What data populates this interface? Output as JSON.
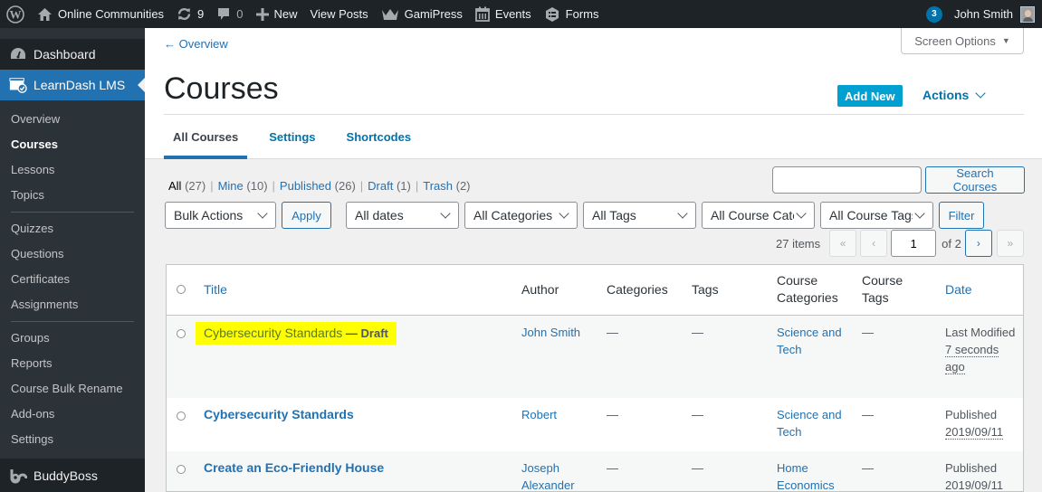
{
  "adminbar": {
    "site_name": "Online Communities",
    "updates_count": "9",
    "comments_count": "0",
    "new_label": "New",
    "view_posts_label": "View Posts",
    "gamipress_label": "GamiPress",
    "events_label": "Events",
    "forms_label": "Forms",
    "notifications_count": "3",
    "user_name": "John Smith"
  },
  "sidebar": {
    "dashboard_label": "Dashboard",
    "learndash_label": "LearnDash LMS",
    "items": [
      {
        "label": "Overview"
      },
      {
        "label": "Courses",
        "active": true
      },
      {
        "label": "Lessons"
      },
      {
        "label": "Topics"
      },
      {
        "label": "Quizzes"
      },
      {
        "label": "Questions"
      },
      {
        "label": "Certificates"
      },
      {
        "label": "Assignments"
      },
      {
        "label": "Groups"
      },
      {
        "label": "Reports"
      },
      {
        "label": "Course Bulk Rename"
      },
      {
        "label": "Add-ons"
      },
      {
        "label": "Settings"
      }
    ],
    "buddyboss_label": "BuddyBoss"
  },
  "header": {
    "back_link": "← Overview",
    "screen_options": "Screen Options",
    "title": "Courses",
    "add_new": "Add New",
    "actions": "Actions",
    "tabs": [
      {
        "label": "All Courses",
        "active": true
      },
      {
        "label": "Settings"
      },
      {
        "label": "Shortcodes"
      }
    ]
  },
  "views": {
    "all": "All",
    "all_count": "(27)",
    "mine": "Mine",
    "mine_count": "(10)",
    "published": "Published",
    "published_count": "(26)",
    "draft": "Draft",
    "draft_count": "(1)",
    "trash": "Trash",
    "trash_count": "(2)"
  },
  "search": {
    "value": "",
    "button": "Search Courses"
  },
  "filters": {
    "bulk_actions": "Bulk Actions",
    "apply": "Apply",
    "dates": "All dates",
    "categories": "All Categories",
    "tags": "All Tags",
    "course_categories": "All Course Categories",
    "course_tags": "All Course Tags",
    "filter": "Filter"
  },
  "pagination": {
    "items": "27 items",
    "first": "«",
    "prev": "‹",
    "current_page": "1",
    "of_pages": "of 2",
    "next": "›",
    "last": "»"
  },
  "table": {
    "columns": [
      "Title",
      "Author",
      "Categories",
      "Tags",
      "Course Categories",
      "Course Tags",
      "Date"
    ],
    "rows": [
      {
        "title": "Cybersecurity Standards",
        "state": "— Draft",
        "author": "John Smith",
        "categories": "—",
        "tags": "—",
        "course_categories": "Science and Tech",
        "course_tags": "—",
        "date_status": "Last Modified",
        "date_value": "7 seconds ago",
        "highlighted": true
      },
      {
        "title": "Cybersecurity Standards",
        "author": "Robert",
        "categories": "—",
        "tags": "—",
        "course_categories": "Science and Tech",
        "course_tags": "—",
        "date_status": "Published",
        "date_value": "2019/09/11"
      },
      {
        "title": "Create an Eco-Friendly House",
        "author": "Joseph Alexander",
        "categories": "—",
        "tags": "—",
        "course_categories": "Home Economics",
        "course_tags": "—",
        "date_status": "Published",
        "date_value": "2019/09/11"
      }
    ]
  },
  "colors": {
    "adminbar_bg": "#1d2327",
    "sidebar_bg": "#2c3338",
    "accent": "#2271b1",
    "add_new_bg": "#00a0d2",
    "highlight": "#ffff00"
  }
}
